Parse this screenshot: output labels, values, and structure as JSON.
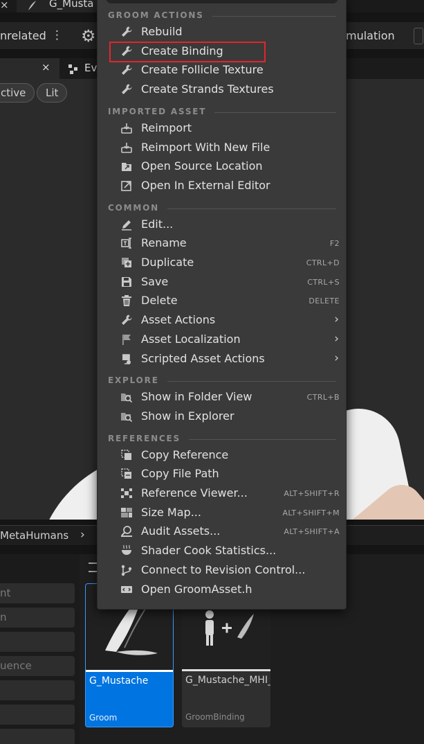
{
  "top_tab": {
    "close_icon": "×",
    "title": "G_Musta"
  },
  "toolbar": {
    "left_text": "nrelated",
    "more_icon": "⋮",
    "right_text": "mulation"
  },
  "viewport_tabs": {
    "close_icon": "×",
    "second_tab": "Ev"
  },
  "viewport": {
    "pill_1": "ctive",
    "pill_2": "Lit"
  },
  "breadcrumb": {
    "path": "MetaHumans",
    "chevron": "›"
  },
  "filter_fields": [
    "nt",
    "n",
    "",
    "uence",
    "",
    "",
    ""
  ],
  "assets": [
    {
      "name": "G_Mustache",
      "type": "Groom"
    },
    {
      "name": "G_Mustache_MHI_Face_Me_New_FaceMesh_...",
      "type": "GroomBinding"
    }
  ],
  "menu": {
    "sections": [
      {
        "title": "GROOM ACTIONS",
        "items": [
          {
            "label": "Rebuild",
            "icon": "wrench-icon",
            "shortcut": ""
          },
          {
            "label": "Create Binding",
            "icon": "wrench-icon",
            "shortcut": ""
          },
          {
            "label": "Create Follicle Texture",
            "icon": "wrench-icon",
            "shortcut": ""
          },
          {
            "label": "Create Strands Textures",
            "icon": "wrench-icon",
            "shortcut": ""
          }
        ]
      },
      {
        "title": "IMPORTED ASSET",
        "items": [
          {
            "label": "Reimport",
            "icon": "reimport-icon",
            "shortcut": ""
          },
          {
            "label": "Reimport With New File",
            "icon": "reimport-icon",
            "shortcut": ""
          },
          {
            "label": "Open Source Location",
            "icon": "open-location-icon",
            "shortcut": ""
          },
          {
            "label": "Open In External Editor",
            "icon": "external-editor-icon",
            "shortcut": ""
          }
        ]
      },
      {
        "title": "COMMON",
        "items": [
          {
            "label": "Edit...",
            "icon": "pencil-icon",
            "shortcut": ""
          },
          {
            "label": "Rename",
            "icon": "rename-icon",
            "shortcut": "F2"
          },
          {
            "label": "Duplicate",
            "icon": "duplicate-icon",
            "shortcut": "CTRL+D"
          },
          {
            "label": "Save",
            "icon": "save-icon",
            "shortcut": "CTRL+S"
          },
          {
            "label": "Delete",
            "icon": "trash-icon",
            "shortcut": "DELETE"
          },
          {
            "label": "Asset Actions",
            "icon": "wrench-icon",
            "shortcut": "",
            "submenu": "›"
          },
          {
            "label": "Asset Localization",
            "icon": "flag-icon",
            "shortcut": "",
            "submenu": "›"
          },
          {
            "label": "Scripted Asset Actions",
            "icon": "scroll-icon",
            "shortcut": "",
            "submenu": "›"
          }
        ]
      },
      {
        "title": "EXPLORE",
        "items": [
          {
            "label": "Show in Folder View",
            "icon": "folder-search-icon",
            "shortcut": "CTRL+B"
          },
          {
            "label": "Show in Explorer",
            "icon": "folder-search-icon",
            "shortcut": ""
          }
        ]
      },
      {
        "title": "REFERENCES",
        "items": [
          {
            "label": "Copy Reference",
            "icon": "copy-reference-icon",
            "shortcut": ""
          },
          {
            "label": "Copy File Path",
            "icon": "copy-path-icon",
            "shortcut": ""
          },
          {
            "label": "Reference Viewer...",
            "icon": "reference-viewer-icon",
            "shortcut": "ALT+SHIFT+R"
          },
          {
            "label": "Size Map...",
            "icon": "size-map-icon",
            "shortcut": "ALT+SHIFT+M"
          },
          {
            "label": "Audit Assets...",
            "icon": "audit-icon",
            "shortcut": "ALT+SHIFT+A"
          },
          {
            "label": "Shader Cook Statistics...",
            "icon": "shader-icon",
            "shortcut": ""
          },
          {
            "label": "Connect to Revision Control...",
            "icon": "revision-control-icon",
            "shortcut": ""
          },
          {
            "label": "Open GroomAsset.h",
            "icon": "code-file-icon",
            "shortcut": ""
          }
        ]
      }
    ]
  },
  "colors": {
    "menu_bg": "#3a3a3a",
    "highlight": "#e0262b",
    "selected_card": "#0074e0"
  }
}
